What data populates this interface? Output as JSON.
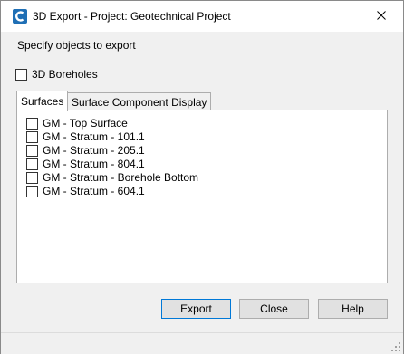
{
  "window": {
    "title": "3D Export - Project: Geotechnical Project",
    "instruction": "Specify objects to export"
  },
  "boreholes": {
    "label": "3D Boreholes",
    "checked": false
  },
  "tabs": [
    {
      "label": "Surfaces",
      "active": true
    },
    {
      "label": "Surface Component Display",
      "active": false
    }
  ],
  "surfaces": [
    {
      "label": "GM - Top Surface",
      "checked": false
    },
    {
      "label": "GM - Stratum - 101.1",
      "checked": false
    },
    {
      "label": "GM - Stratum - 205.1",
      "checked": false
    },
    {
      "label": "GM - Stratum - 804.1",
      "checked": false
    },
    {
      "label": "GM - Stratum - Borehole Bottom",
      "checked": false
    },
    {
      "label": "GM - Stratum - 604.1",
      "checked": false
    }
  ],
  "buttons": {
    "export": "Export",
    "close": "Close",
    "help": "Help"
  },
  "icons": {
    "app": "civil3d-c-icon",
    "close": "close-icon",
    "grip": "resize-grip-icon"
  },
  "colors": {
    "app_icon": "#1f6fb5",
    "default_button_border": "#0078d7"
  }
}
